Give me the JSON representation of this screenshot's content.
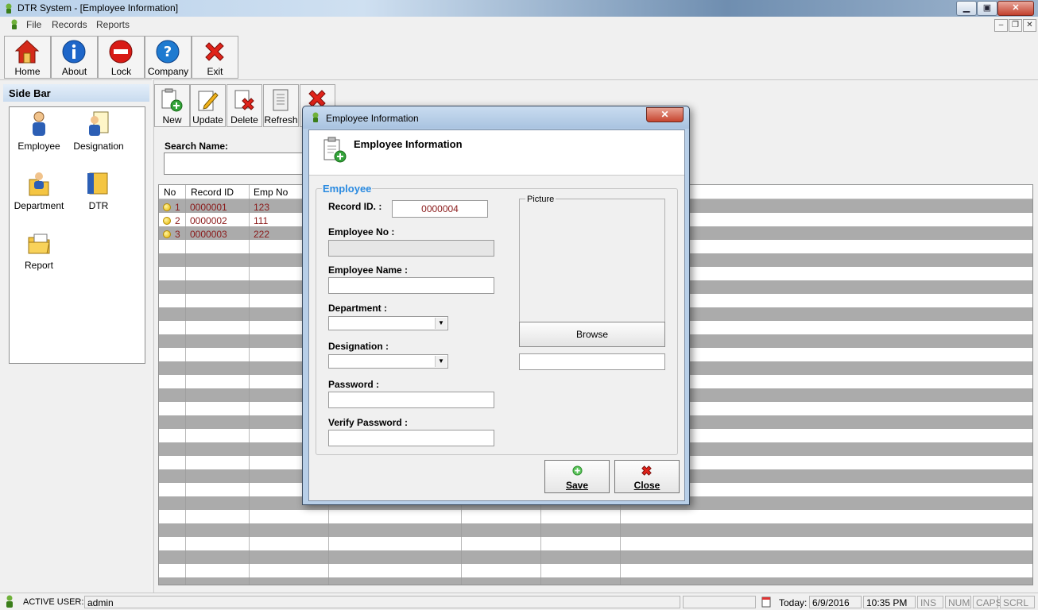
{
  "window": {
    "title": "DTR System - [Employee Information]",
    "min": "▁",
    "max": "▣",
    "close": "✕"
  },
  "menu": {
    "items": [
      "File",
      "Records",
      "Reports"
    ],
    "mdi": {
      "min": "–",
      "restore": "❐",
      "close": "✕"
    }
  },
  "toolbar": {
    "buttons": [
      "Home",
      "About",
      "Lock",
      "Company",
      "Exit"
    ]
  },
  "sidebar": {
    "title": "Side Bar",
    "items": [
      "Employee",
      "Designation",
      "Department",
      "DTR",
      "Report"
    ]
  },
  "content_toolbar": {
    "buttons": [
      "New",
      "Update",
      "Delete",
      "Refresh"
    ]
  },
  "search": {
    "label": "Search Name:",
    "value": ""
  },
  "grid": {
    "columns": [
      "No",
      "Record ID",
      "Emp No"
    ],
    "rows": [
      {
        "no": "1",
        "record_id": "0000001",
        "emp_no": "123"
      },
      {
        "no": "2",
        "record_id": "0000002",
        "emp_no": "111"
      },
      {
        "no": "3",
        "record_id": "0000003",
        "emp_no": "222"
      }
    ]
  },
  "dialog": {
    "title": "Employee Information",
    "close_glyph": "✕",
    "header": "Employee Information",
    "group_label": "Employee",
    "fields": {
      "record_id_label": "Record ID. :",
      "record_id_value": "0000004",
      "employee_no_label": "Employee No :",
      "employee_name_label": "Employee Name :",
      "department_label": "Department :",
      "designation_label": "Designation :",
      "password_label": "Password :",
      "verify_password_label": "Verify Password :"
    },
    "picture_label": "Picture",
    "browse_label": "Browse",
    "save_label": "Save",
    "close_label": "Close"
  },
  "status": {
    "active_user_label": "ACTIVE USER:",
    "active_user": "admin",
    "today_label": "Today:",
    "date": "6/9/2016",
    "time": "10:35 PM",
    "ins": "INS",
    "num": "NUM",
    "caps": "CAPS",
    "scrl": "SCRL"
  },
  "colors": {
    "accent": "#2a8ae0",
    "row_text": "#8a1a1a",
    "grid_stripe": "#ababab"
  }
}
